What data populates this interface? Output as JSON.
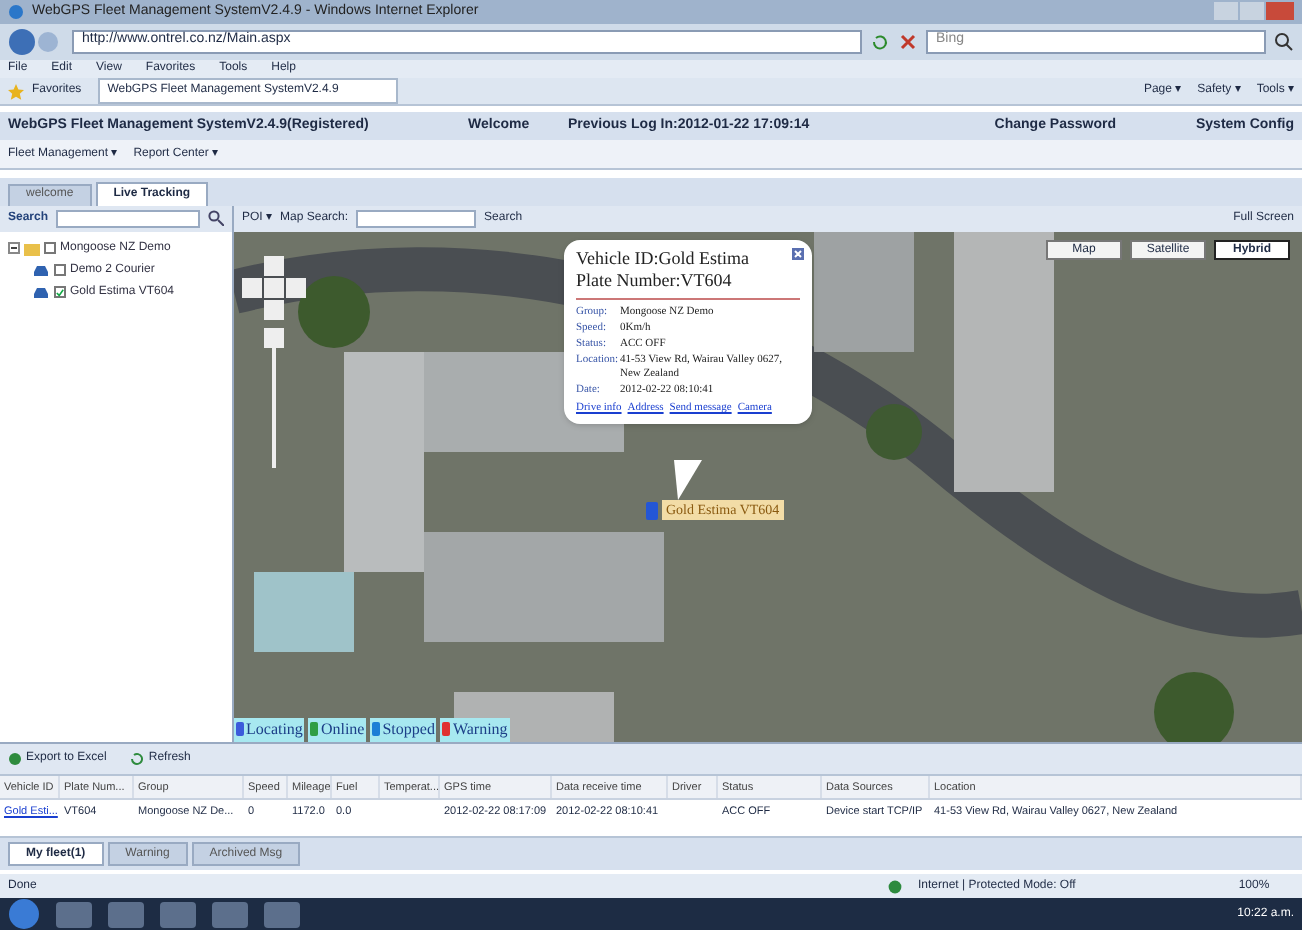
{
  "window": {
    "title": "WebGPS Fleet Management SystemV2.4.9 - Windows Internet Explorer"
  },
  "browser": {
    "address": "http://www.ontrel.co.nz/Main.aspx",
    "search_placeholder": "Bing",
    "menu": [
      "File",
      "Edit",
      "View",
      "Favorites",
      "Tools",
      "Help"
    ],
    "favorites": "Favorites",
    "tab": "WebGPS Fleet Management SystemV2.4.9",
    "commands": [
      "Page ▾",
      "Safety ▾",
      "Tools ▾"
    ]
  },
  "app_header": {
    "title": "WebGPS Fleet Management SystemV2.4.9(Registered)",
    "welcome": "Welcome",
    "last_login": "Previous Log In:2012-01-22 17:09:14",
    "links": [
      "Change Password",
      "System Config"
    ]
  },
  "menu": [
    "Fleet Management ▾",
    "Report Center ▾"
  ],
  "tabs": [
    {
      "label": "welcome",
      "selected": false
    },
    {
      "label": "Live Tracking",
      "selected": true
    }
  ],
  "search": {
    "label": "Search"
  },
  "map_toolbar": {
    "poi": "POI ▾",
    "map_search_label": "Map Search:",
    "search_button": "Search",
    "full_screen": "Full Screen"
  },
  "tree": [
    {
      "label": "Mongoose NZ Demo",
      "expanded": true,
      "checked": false,
      "children": [
        {
          "label": "Demo 2 Courier",
          "checked": false
        },
        {
          "label": "Gold Estima VT604",
          "checked": true
        }
      ]
    }
  ],
  "map_types": [
    {
      "label": "Map",
      "selected": false
    },
    {
      "label": "Satellite",
      "selected": false
    },
    {
      "label": "Hybrid",
      "selected": true
    }
  ],
  "popup": {
    "title_lines": [
      "Vehicle ID:Gold Estima",
      "Plate Number:VT604"
    ],
    "fields": [
      {
        "label": "Group:",
        "value": "Mongoose NZ Demo"
      },
      {
        "label": "Speed:",
        "value": "0Km/h"
      },
      {
        "label": "Status:",
        "value": "ACC OFF"
      },
      {
        "label": "Location:",
        "value": "41-53 View Rd, Wairau Valley 0627, New Zealand"
      },
      {
        "label": "Date:",
        "value": "2012-02-22 08:10:41"
      }
    ],
    "links": [
      "Drive info",
      "Address",
      "Send message",
      "Camera"
    ]
  },
  "marker": {
    "label": "Gold Estima VT604"
  },
  "legend": [
    {
      "label": "Locating",
      "color": "#3b5bdb"
    },
    {
      "label": "Online",
      "color": "#2f9e44"
    },
    {
      "label": "Stopped",
      "color": "#1c7ed6"
    },
    {
      "label": "Warning",
      "color": "#e03131"
    }
  ],
  "grid_toolbar": [
    "Export to Excel",
    "Refresh"
  ],
  "table": {
    "columns": [
      "Vehicle ID",
      "Plate Num...",
      "Group",
      "Speed",
      "Mileage",
      "Fuel",
      "Temperat...",
      "GPS time",
      "Data receive time",
      "Driver",
      "Status",
      "Data Sources",
      "Location"
    ],
    "rows": [
      [
        "Gold Esti...",
        "VT604",
        "Mongoose NZ De...",
        "0",
        "1172.0",
        "0.0",
        "",
        "2012-02-22 08:17:09",
        "2012-02-22 08:10:41",
        "",
        "ACC OFF",
        "Device start TCP/IP",
        "41-53 View Rd, Wairau Valley 0627, New Zealand"
      ]
    ]
  },
  "bottom_tabs": [
    {
      "label": "My fleet(1)",
      "selected": true
    },
    {
      "label": "Warning",
      "selected": false
    },
    {
      "label": "Archived Msg",
      "selected": false
    }
  ],
  "status_bar": {
    "text": "Done",
    "zone": "Internet | Protected Mode: Off",
    "zoom": "100%"
  },
  "taskbar": {
    "time": "10:22 a.m."
  }
}
